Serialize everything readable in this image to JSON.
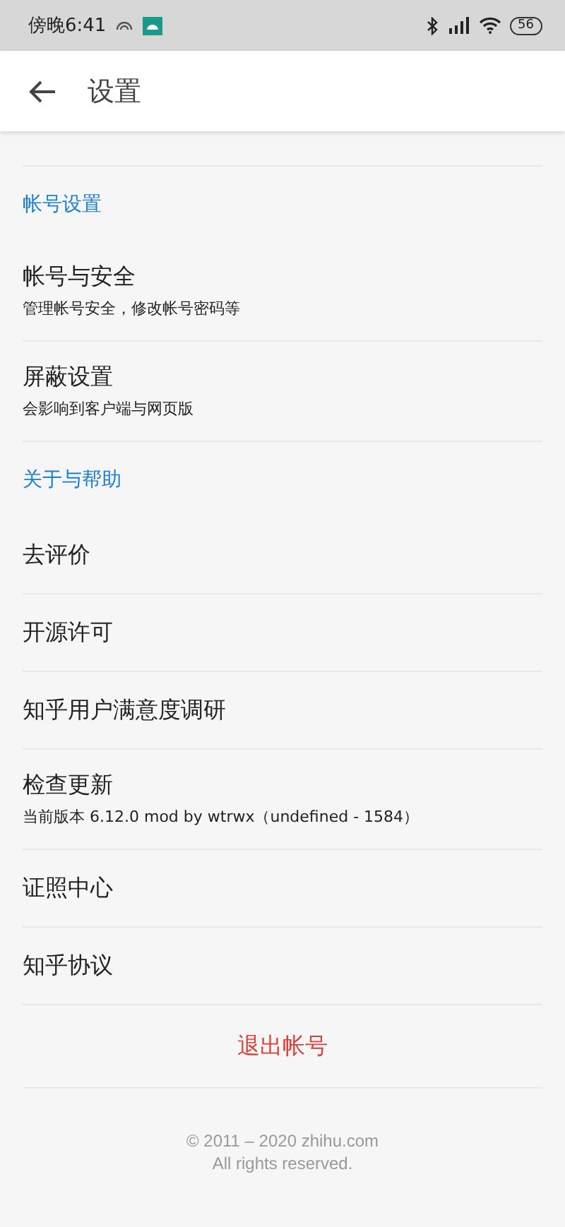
{
  "status_bar": {
    "time": "傍晚6:41",
    "battery": "56"
  },
  "header": {
    "title": "设置"
  },
  "sections": [
    {
      "title": "帐号设置",
      "items": [
        {
          "label": "帐号与安全",
          "subtitle": "管理帐号安全，修改帐号密码等"
        },
        {
          "label": "屏蔽设置",
          "subtitle": "会影响到客户端与网页版"
        }
      ]
    },
    {
      "title": "关于与帮助",
      "items": [
        {
          "label": "去评价"
        },
        {
          "label": "开源许可"
        },
        {
          "label": "知乎用户满意度调研"
        },
        {
          "label": "检查更新",
          "subtitle": "当前版本 6.12.0 mod by wtrwx（undefined - 1584）"
        },
        {
          "label": "证照中心"
        },
        {
          "label": "知乎协议"
        }
      ]
    }
  ],
  "logout": "退出帐号",
  "footer": [
    "© 2011 – 2020 zhihu.com",
    "All rights reserved."
  ]
}
